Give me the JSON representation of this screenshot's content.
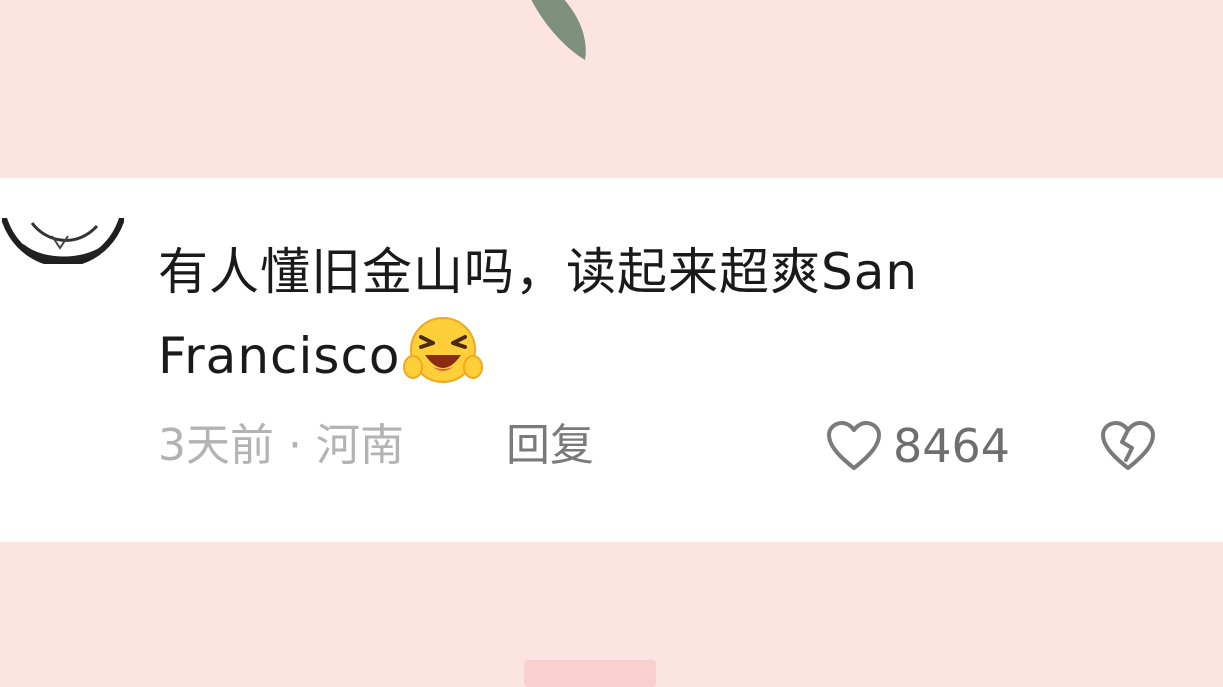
{
  "comment": {
    "text_line1": "有人懂旧金山吗，读起来超爽San",
    "text_line2": "Francisco",
    "emoji_icon": "laughing-crying-emoji-icon",
    "time": "3天前",
    "separator": "·",
    "location": "河南",
    "reply_label": "回复",
    "like_count": "8464",
    "like_icon": "heart-outline-icon",
    "dislike_icon": "broken-heart-icon"
  },
  "colors": {
    "background": "#fbe4e2",
    "card": "#ffffff",
    "text": "#1a1a1a",
    "meta": "#b3b3b3",
    "action": "#7a7a7a"
  }
}
